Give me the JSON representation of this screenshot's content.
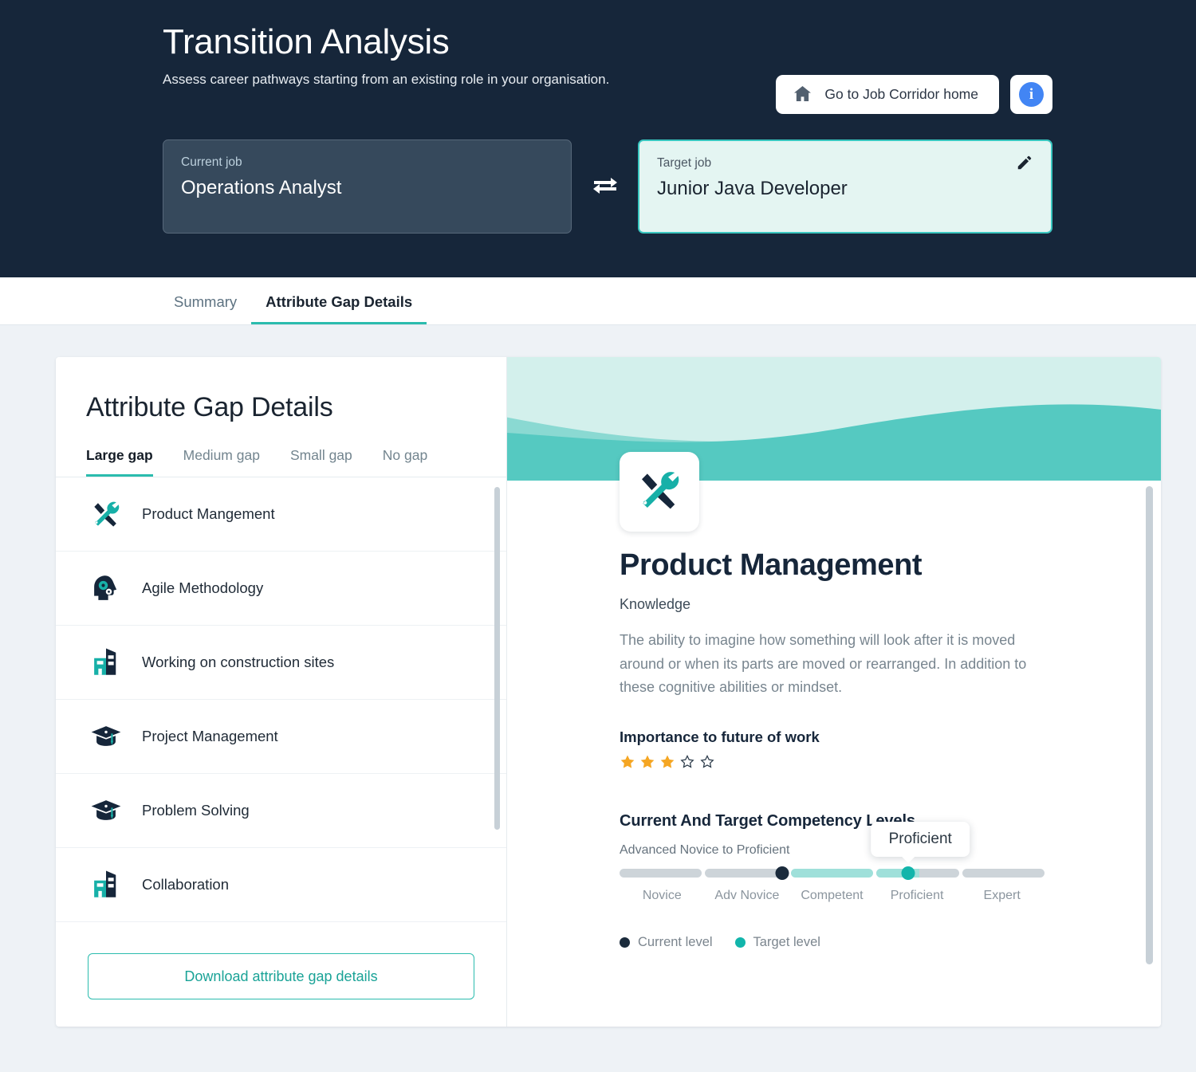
{
  "header": {
    "title": "Transition Analysis",
    "subtitle": "Assess career pathways starting from an existing role in your organisation.",
    "home_button": "Go to Job Corridor home",
    "home_icon": "home-icon",
    "info_button": "i",
    "swap_icon": "swap-arrows-icon",
    "edit_icon": "pencil-icon",
    "current_job": {
      "label": "Current job",
      "value": "Operations Analyst"
    },
    "target_job": {
      "label": "Target job",
      "value": "Junior Java Developer"
    }
  },
  "tabs": [
    {
      "label": "Summary",
      "active": false
    },
    {
      "label": "Attribute Gap Details",
      "active": true
    }
  ],
  "left_panel": {
    "title": "Attribute Gap Details",
    "gap_tabs": [
      {
        "label": "Large gap",
        "active": true
      },
      {
        "label": "Medium gap",
        "active": false
      },
      {
        "label": "Small gap",
        "active": false
      },
      {
        "label": "No gap",
        "active": false
      }
    ],
    "attributes": [
      {
        "name": "Product Mangement",
        "icon": "hammer-wrench-icon"
      },
      {
        "name": "Agile Methodology",
        "icon": "head-gears-icon"
      },
      {
        "name": "Working on construction sites",
        "icon": "buildings-icon"
      },
      {
        "name": "Project Management",
        "icon": "graduation-cap-icon"
      },
      {
        "name": "Problem Solving",
        "icon": "graduation-cap-icon"
      },
      {
        "name": "Collaboration",
        "icon": "buildings-icon"
      }
    ],
    "download_button": "Download attribute gap details"
  },
  "detail": {
    "avatar_icon": "hammer-wrench-icon",
    "title": "Product Management",
    "type": "Knowledge",
    "description": "The ability to imagine how something will look after it is moved around or when its parts are moved or rearranged. In addition to these cognitive abilities or mindset.",
    "importance_label": "Importance to future of work",
    "importance_rating": 3,
    "importance_max": 5,
    "competency": {
      "title": "Current And Target Competency Levels",
      "range_text": "Advanced Novice to Proficient",
      "tooltip": "Proficient",
      "ticks": [
        "Novice",
        "Adv Novice",
        "Competent",
        "Proficient",
        "Expert"
      ],
      "current_level": "Adv Novice",
      "target_level": "Proficient",
      "legend": [
        {
          "label": "Current level",
          "color": "#1b2b3c"
        },
        {
          "label": "Target level",
          "color": "#12b5ab"
        }
      ]
    }
  },
  "colors": {
    "header_bg": "#16263a",
    "accent_teal": "#2bbcae",
    "target_card_bg": "#e4f5f2",
    "star_gold": "#f5a623",
    "info_blue": "#4285f4"
  }
}
